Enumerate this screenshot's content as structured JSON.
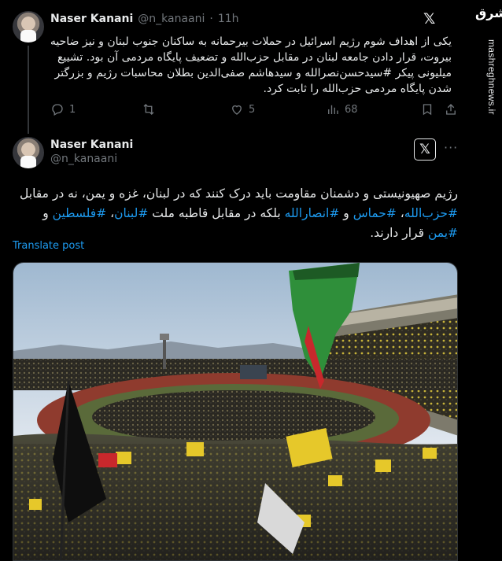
{
  "watermark": {
    "logo": "مشرق",
    "site": "mashreghnews.ir"
  },
  "tweet1": {
    "name": "Naser Kanani",
    "handle": "@n_kanaani",
    "time": "11h",
    "text": "یکی از اهداف شوم رژیم اسرائیل در حملات بیرحمانه به ساکنان جنوب لبنان و نیز ضاحیه بیروت، قرار دادن جامعه لبنان در مقابل حزب‌الله و تضعیف پایگاه مردمی آن بود. تشییع میلیونی پیکر #سیدحسن‌نصرالله و سیدهاشم صفی‌الدین بطلان محاسبات رژیم و بزرگتر شدن پایگاه مردمی حزب‌الله را ثابت کرد.",
    "replies": "1",
    "reposts": "",
    "likes": "5",
    "views": "68"
  },
  "tweet2": {
    "name": "Naser Kanani",
    "handle": "@n_kanaani",
    "text_segments": [
      {
        "t": "رژیم صهیونیستی و دشمنان مقاومت باید درک کنند که در لبنان، غزه و یمن، نه در مقابل ",
        "tag": false
      },
      {
        "t": "#حزب‌الله",
        "tag": true
      },
      {
        "t": "، ",
        "tag": false
      },
      {
        "t": "#حماس",
        "tag": true
      },
      {
        "t": " و ",
        "tag": false
      },
      {
        "t": "#انصارالله",
        "tag": true
      },
      {
        "t": " بلکه در مقابل قاطبه ملت ",
        "tag": false
      },
      {
        "t": "#لبنان",
        "tag": true
      },
      {
        "t": "، ",
        "tag": false
      },
      {
        "t": "#فلسطین",
        "tag": true
      },
      {
        "t": " و ",
        "tag": false
      },
      {
        "t": "#یمن",
        "tag": true
      },
      {
        "t": " قرار دارند.",
        "tag": false
      }
    ],
    "translate_label": "Translate post"
  },
  "colors": {
    "accent": "#1d9bf0",
    "muted": "#71767b",
    "bg": "#000000",
    "text": "#e7e9ea"
  },
  "icons": [
    "x-logo-icon",
    "more-options-icon",
    "reply-icon",
    "repost-icon",
    "like-icon",
    "views-icon",
    "bookmark-icon",
    "share-icon"
  ]
}
